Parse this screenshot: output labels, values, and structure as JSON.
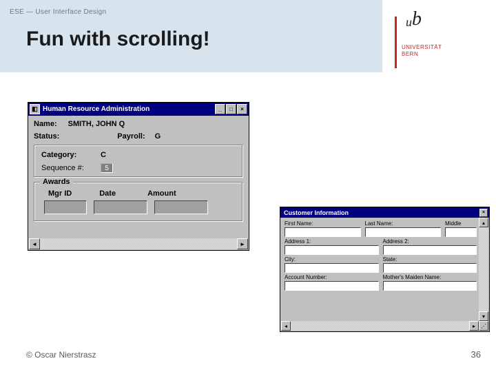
{
  "header": {
    "course": "ESE — User Interface Design",
    "title": "Fun with scrolling!",
    "logo": {
      "mark": "u",
      "mark2": "b",
      "line1": "UNIVERSITÄT",
      "line2": "BERN"
    }
  },
  "win1": {
    "title": "Human Resource Administration",
    "name_label": "Name:",
    "name_value": "SMITH, JOHN Q",
    "status_label": "Status:",
    "payroll_label": "Payroll:",
    "payroll_value": "G",
    "category_label": "Category:",
    "category_value": "C",
    "sequence_label": "Sequence #:",
    "sequence_value": "5",
    "awards_legend": "Awards",
    "cols": [
      "Mgr ID",
      "Date",
      "Amount"
    ]
  },
  "win2": {
    "title": "Customer Information",
    "fields": {
      "first": "First Name:",
      "last": "Last Name:",
      "middle": "Middle",
      "addr1": "Address 1:",
      "addr2": "Address 2:",
      "city": "City:",
      "state": "State:",
      "acct": "Account Number:",
      "maiden": "Mother's Maiden Name:"
    }
  },
  "footer": {
    "copyright": "© Oscar Nierstrasz",
    "page": "36"
  }
}
